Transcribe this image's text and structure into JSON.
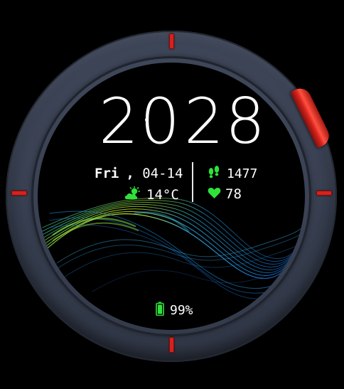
{
  "watch": {
    "time": {
      "hours": "20",
      "minutes": "28"
    },
    "date": {
      "weekday": "Fri",
      "separator": ",",
      "day": "04-14"
    },
    "weather": {
      "icon": "cloud-sun-icon",
      "temperature": "14°C"
    },
    "steps": {
      "icon": "footsteps-icon",
      "value": "1477"
    },
    "heart_rate": {
      "icon": "heart-icon",
      "value": "78"
    },
    "battery": {
      "icon": "battery-icon",
      "value": "99%"
    }
  },
  "colors": {
    "accent_green": "#2fe13a",
    "marker_red": "#d8211c",
    "bezel": "#3a4254",
    "text": "#ffffff"
  }
}
